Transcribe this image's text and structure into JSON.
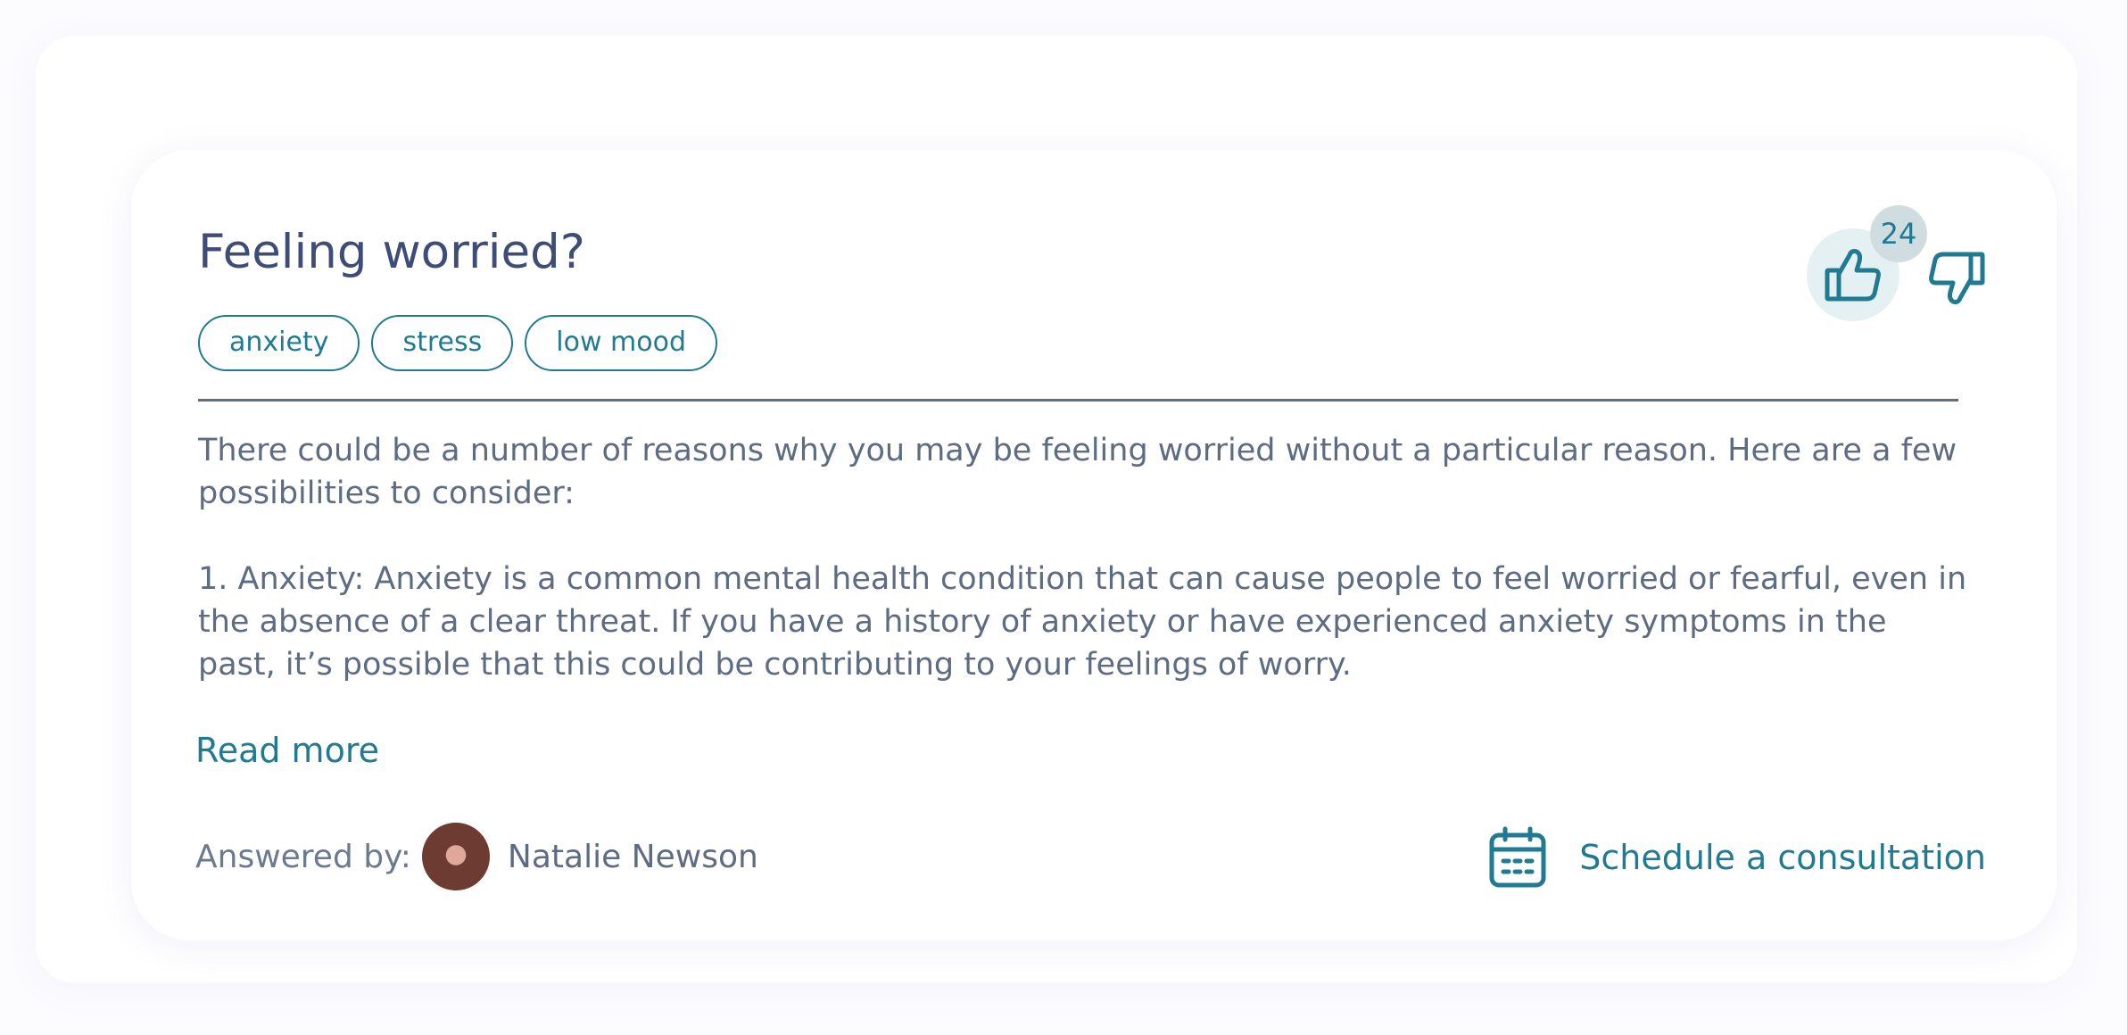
{
  "card": {
    "title": "Feeling worried?",
    "tags": [
      "anxiety",
      "stress",
      "low mood"
    ],
    "paragraphs": [
      "There could be a number of reasons why you may be feeling worried without a particular reason. Here are a few possibilities to consider:",
      "1. Anxiety: Anxiety is a common mental health condition that can cause people to feel worried or fearful, even in the absence of a clear threat. If you have a history of anxiety or have experienced anxiety symptoms in the past, it’s possible that this could be contributing to your feelings of worry."
    ],
    "read_more": "Read more",
    "answered_by_label": "Answered by:",
    "author_name": "Natalie Newson",
    "schedule_label": "Schedule a consultation",
    "likes_count": "24"
  },
  "icons": {
    "like": "thumbs-up-icon",
    "dislike": "thumbs-down-icon",
    "schedule": "calendar-icon"
  },
  "colors": {
    "accent": "#1f7a92",
    "title": "#3e4d77",
    "body_text": "#5d6c82",
    "like_bg": "#e5f0f3",
    "count_bg": "#cfdde0"
  }
}
